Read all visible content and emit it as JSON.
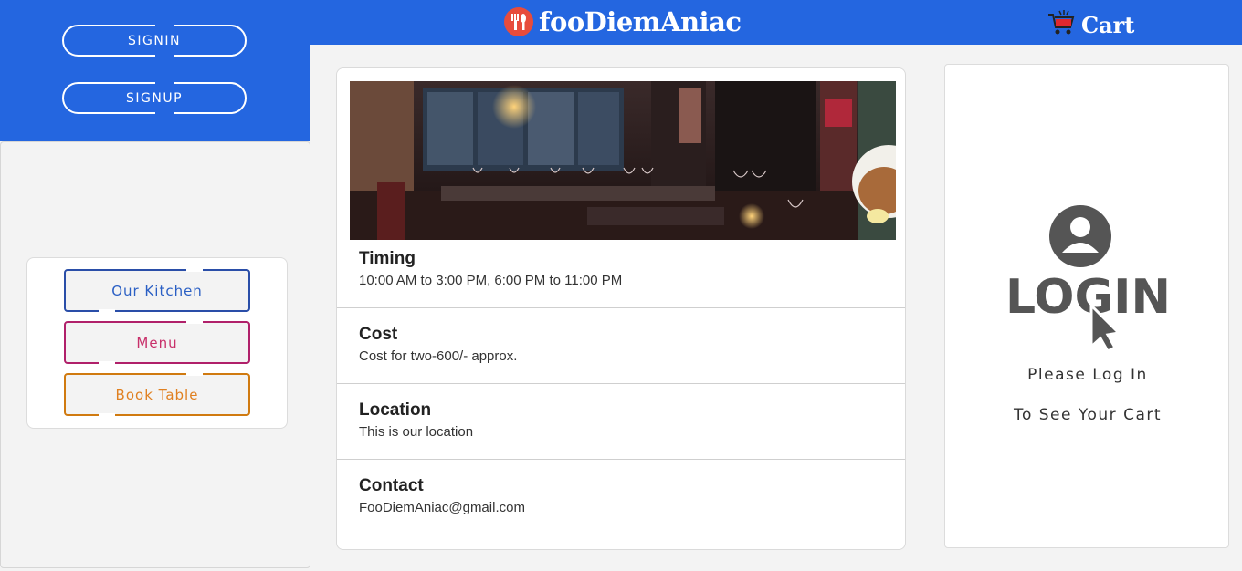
{
  "header": {
    "brand": "fooDiemAniac",
    "cart_label": "Cart"
  },
  "auth": {
    "signin_label": "SIGNIN",
    "signup_label": "SIGNUP"
  },
  "nav": {
    "items": [
      {
        "label": "Our Kitchen"
      },
      {
        "label": "Menu"
      },
      {
        "label": "Book Table"
      }
    ]
  },
  "info": {
    "sections": [
      {
        "title": "Timing",
        "value": "10:00 AM to 3:00 PM, 6:00 PM to 11:00 PM"
      },
      {
        "title": "Cost",
        "value": "Cost for two-600/- approx."
      },
      {
        "title": "Location",
        "value": "This is our location"
      },
      {
        "title": "Contact",
        "value": "FooDiemAniac@gmail.com"
      }
    ]
  },
  "cart_panel": {
    "login_graphic_text": "LOGIN",
    "message_line1": "Please Log In",
    "message_line2": "To See Your Cart"
  },
  "colors": {
    "primary_blue": "#2466e0",
    "kitchen_border": "#2a4ea8",
    "menu_border": "#b0206a",
    "book_border": "#d07a10"
  },
  "icons": [
    "fork-spoon-logo-icon",
    "shopping-cart-icon",
    "user-avatar-icon",
    "cursor-pointer-icon"
  ]
}
